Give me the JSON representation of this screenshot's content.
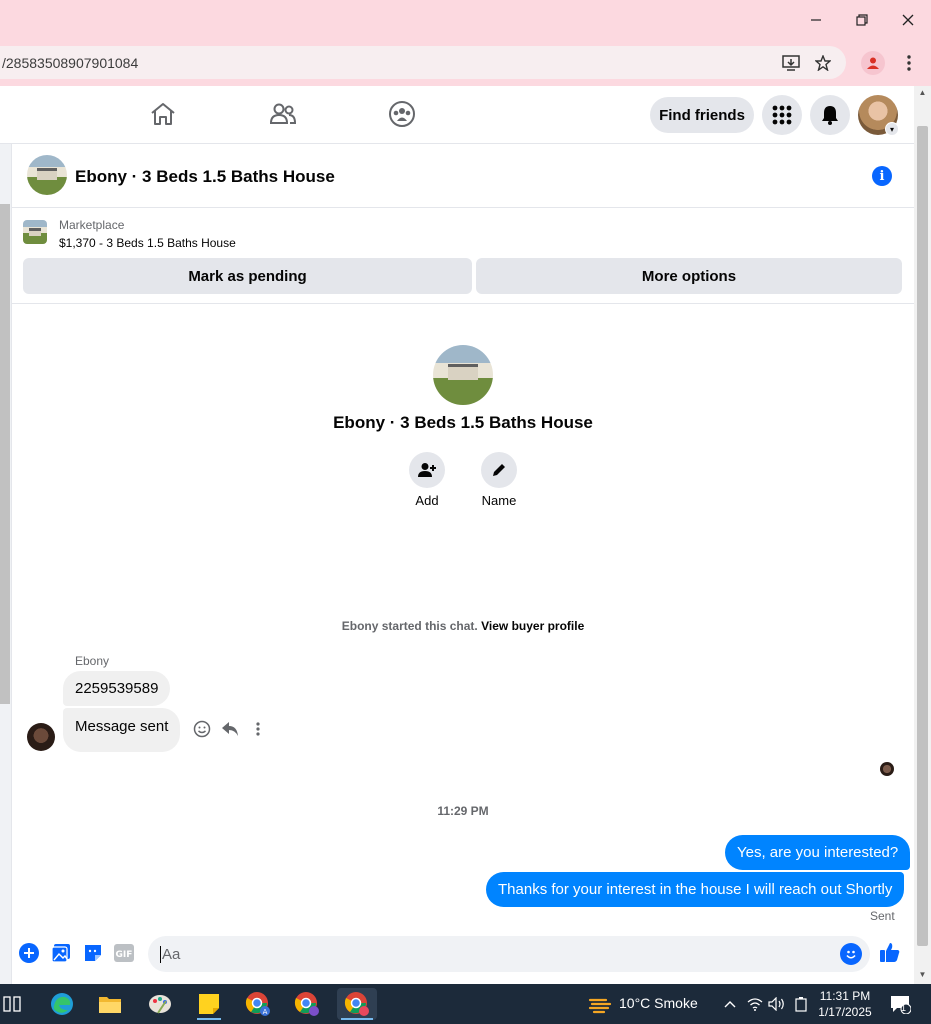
{
  "browser": {
    "url": "/28583508907901084"
  },
  "fb_nav": {
    "find_friends": "Find friends"
  },
  "chat": {
    "title": "Ebony · 3 Beds 1.5 Baths House",
    "marketplace": {
      "label": "Marketplace",
      "listing": "$1,370 - 3 Beds 1.5 Baths House",
      "mark_pending": "Mark as pending",
      "more_options": "More options"
    },
    "intro": {
      "title": "Ebony · 3 Beds 1.5 Baths House",
      "add_label": "Add",
      "name_label": "Name"
    },
    "started_text": "Ebony started this chat.",
    "view_profile": "View buyer profile",
    "sender_name": "Ebony",
    "messages_in": [
      {
        "text": "2259539589"
      },
      {
        "text": "Message sent"
      }
    ],
    "timestamp": "11:29 PM",
    "messages_out": [
      {
        "text": "Yes, are you interested?"
      },
      {
        "text": "Thanks for your interest in the house I will reach out Shortly"
      }
    ],
    "sent_label": "Sent",
    "composer_placeholder": "Aa"
  },
  "taskbar": {
    "weather": "10°C  Smoke",
    "time": "11:31 PM",
    "date": "1/17/2025",
    "notification_count": "1"
  },
  "colors": {
    "titlebar": "#fcd9e0",
    "messenger_blue": "#0084ff",
    "fb_blue": "#0866ff",
    "taskbar": "#1c2a3a"
  }
}
